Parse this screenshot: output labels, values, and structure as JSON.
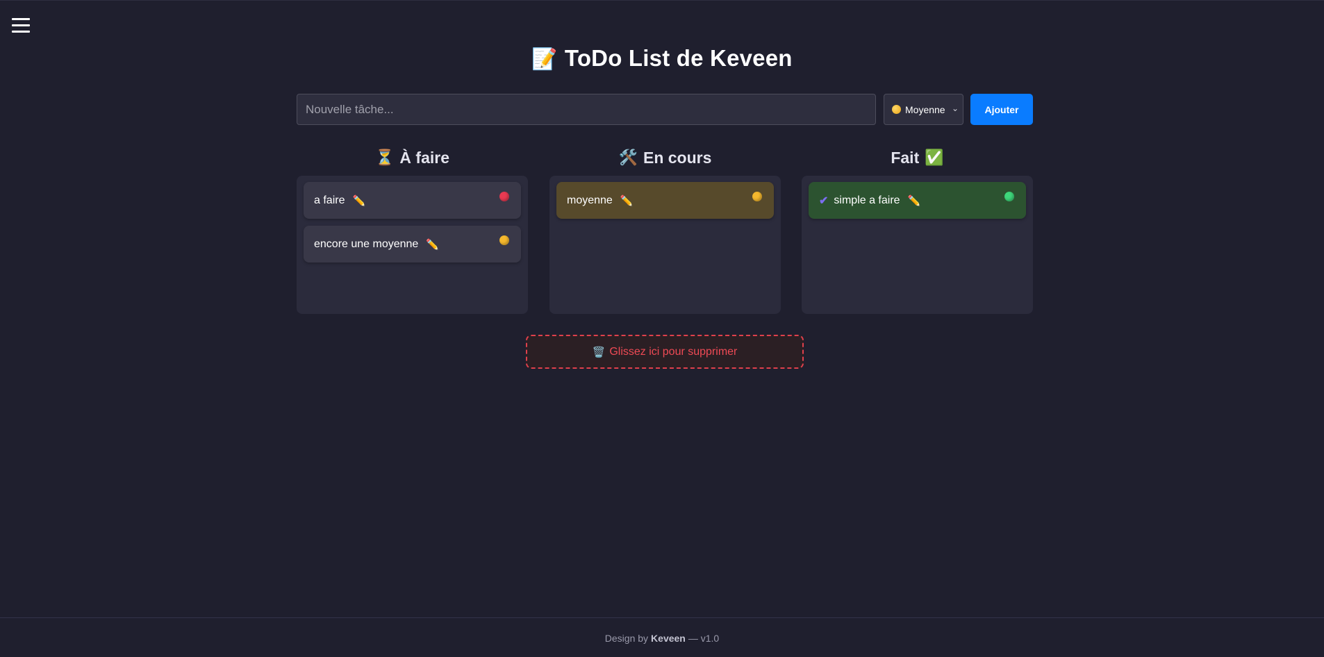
{
  "header": {
    "title_emoji": "📝",
    "title": "ToDo List de Keveen"
  },
  "menu": {
    "icon": "hamburger-menu-icon"
  },
  "form": {
    "placeholder": "Nouvelle tâche...",
    "value": "",
    "priority": {
      "label": "Moyenne",
      "color": "#f5b82e"
    },
    "add_label": "Ajouter",
    "add_color": "#0a7cff"
  },
  "columns": [
    {
      "emoji": "⏳",
      "title": "À faire",
      "tasks": [
        {
          "text": "a faire",
          "priority_color": "#e83a52"
        },
        {
          "text": "encore une moyenne",
          "priority_color": "#f5b82e"
        }
      ]
    },
    {
      "emoji": "🛠️",
      "title": "En cours",
      "tasks": [
        {
          "text": "moyenne",
          "priority_color": "#f5b82e"
        }
      ]
    },
    {
      "title": "Fait",
      "emoji_after": "✅",
      "tasks": [
        {
          "check": "✔",
          "text": "simple a faire",
          "priority_color": "#3ed67a"
        }
      ]
    }
  ],
  "trash": {
    "emoji": "🗑️",
    "label": "Glissez ici pour supprimer"
  },
  "footer": {
    "prefix": "Design by",
    "author": "Keveen",
    "suffix": "— v1.0"
  },
  "colors": {
    "background": "#1f1f2e",
    "card_todo": "#393848",
    "card_inprogress": "#574a2b",
    "card_done": "#2c5330",
    "danger": "#e0404c"
  }
}
